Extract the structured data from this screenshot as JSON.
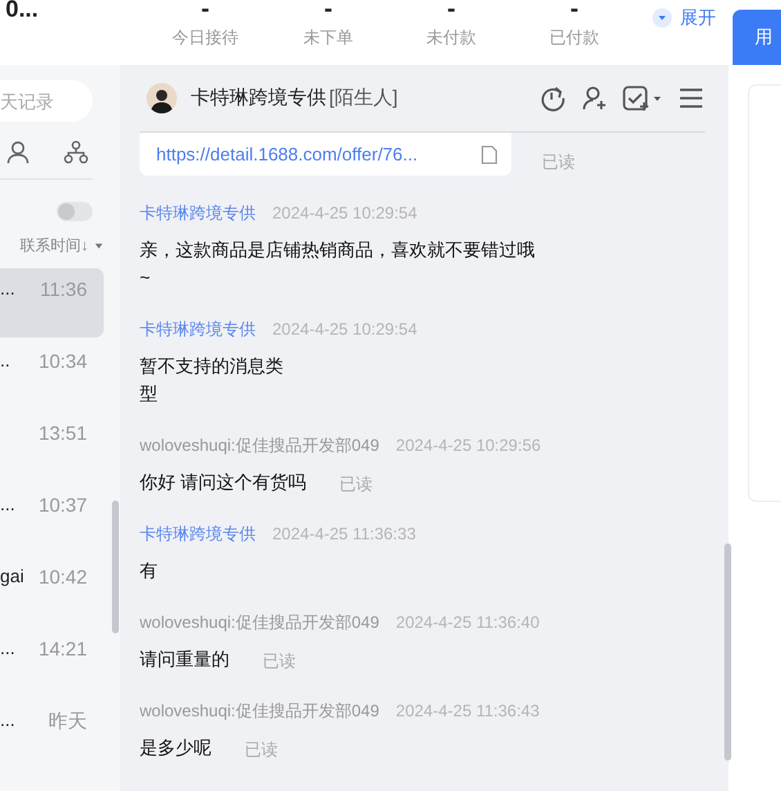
{
  "top": {
    "title": "0...",
    "stats": [
      {
        "value": "-",
        "label": "今日接待"
      },
      {
        "value": "-",
        "label": "未下单"
      },
      {
        "value": "-",
        "label": "未付款"
      },
      {
        "value": "-",
        "label": "已付款"
      }
    ],
    "expand": "展开",
    "side_button": "用"
  },
  "sidebar": {
    "search_placeholder": "天记录",
    "toggle_on": false,
    "sort": "联系时间↓",
    "contacts": [
      {
        "name": "...",
        "time": "11:36",
        "selected": true
      },
      {
        "name": "..",
        "time": "10:34",
        "selected": false
      },
      {
        "time": "13:51",
        "selected": false
      },
      {
        "name": "...",
        "time": "10:37",
        "selected": false
      },
      {
        "name": "gai",
        "time": "10:42",
        "selected": false
      },
      {
        "name": "...",
        "time": "14:21",
        "selected": false
      },
      {
        "name": "...",
        "time": "昨天",
        "selected": false
      }
    ]
  },
  "chat": {
    "name": "卡特琳跨境专供",
    "tag": "[陌生人]",
    "messages": [
      {
        "kind": "link",
        "text": "https://detail.1688.com/offer/76...",
        "status": "已读"
      },
      {
        "kind": "text",
        "own": false,
        "sender": "卡特琳跨境专供",
        "time": "2024-4-25 10:29:54",
        "text": "亲，这款商品是店铺热销商品，喜欢就不要错过哦~"
      },
      {
        "kind": "unsupported",
        "own": false,
        "sender": "卡特琳跨境专供",
        "time": "2024-4-25 10:29:54",
        "text": "暂不支持的消息类型"
      },
      {
        "kind": "text",
        "own": true,
        "sender": "woloveshuqi:促佳搜品开发部049",
        "time": "2024-4-25 10:29:56",
        "text": "你好 请问这个有货吗",
        "status": "已读"
      },
      {
        "kind": "text",
        "own": false,
        "sender": "卡特琳跨境专供",
        "time": "2024-4-25 11:36:33",
        "text": "有"
      },
      {
        "kind": "text",
        "own": true,
        "sender": "woloveshuqi:促佳搜品开发部049",
        "time": "2024-4-25 11:36:40",
        "text": "请问重量的",
        "status": "已读"
      },
      {
        "kind": "text",
        "own": true,
        "sender": "woloveshuqi:促佳搜品开发部049",
        "time": "2024-4-25 11:36:43",
        "text": "是多少呢",
        "status": "已读"
      }
    ]
  }
}
